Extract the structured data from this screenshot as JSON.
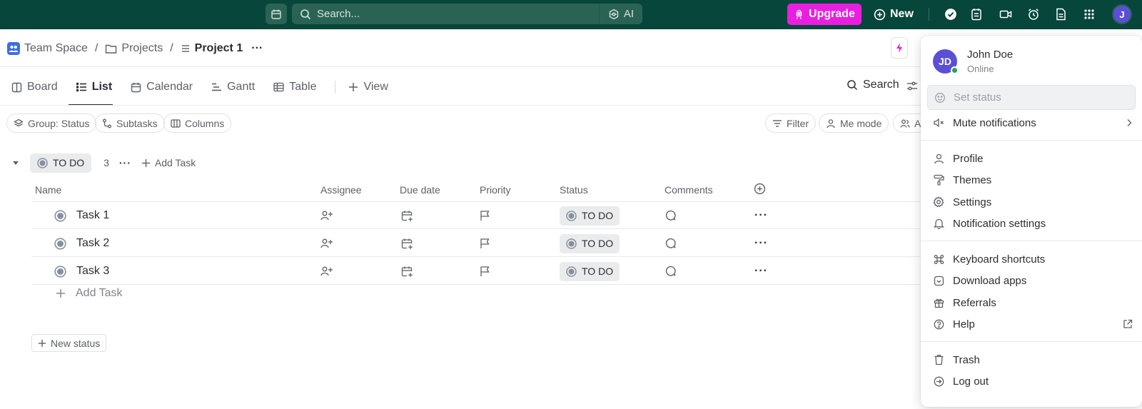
{
  "topbar": {
    "search_placeholder": "Search...",
    "ai_label": "AI",
    "upgrade_label": "Upgrade",
    "new_label": "New",
    "avatar_initial": "J"
  },
  "breadcrumb": {
    "workspace": "Team Space",
    "folder": "Projects",
    "current": "Project 1",
    "more": "···"
  },
  "tabs": {
    "items": [
      {
        "label": "Board",
        "active": false
      },
      {
        "label": "List",
        "active": true
      },
      {
        "label": "Calendar",
        "active": false
      },
      {
        "label": "Gantt",
        "active": false
      },
      {
        "label": "Table",
        "active": false
      }
    ],
    "add_view": "View",
    "search": "Search"
  },
  "chips": {
    "group": "Group: Status",
    "subtasks": "Subtasks",
    "columns": "Columns",
    "filter": "Filter",
    "me_mode": "Me mode",
    "assignee_partial": "A"
  },
  "group": {
    "status": "TO DO",
    "count": "3",
    "more": "···",
    "add_task": "Add Task"
  },
  "columns": {
    "name": "Name",
    "assignee": "Assignee",
    "due_date": "Due date",
    "priority": "Priority",
    "status": "Status",
    "comments": "Comments"
  },
  "tasks": [
    {
      "name": "Task 1",
      "status": "TO DO"
    },
    {
      "name": "Task 2",
      "status": "TO DO"
    },
    {
      "name": "Task 3",
      "status": "TO DO"
    }
  ],
  "add_task_row": "Add Task",
  "new_status": "New status",
  "menu": {
    "user_initials": "JD",
    "user_name": "John Doe",
    "user_status": "Online",
    "set_status": "Set status",
    "mute": "Mute notifications",
    "profile": "Profile",
    "themes": "Themes",
    "settings": "Settings",
    "notification_settings": "Notification settings",
    "keyboard_shortcuts": "Keyboard shortcuts",
    "download_apps": "Download apps",
    "referrals": "Referrals",
    "help": "Help",
    "trash": "Trash",
    "logout": "Log out"
  },
  "colors": {
    "topbar": "#07463a",
    "upgrade": "#e81fe1",
    "avatar": "#5b4fd6",
    "online": "#23a35a"
  }
}
